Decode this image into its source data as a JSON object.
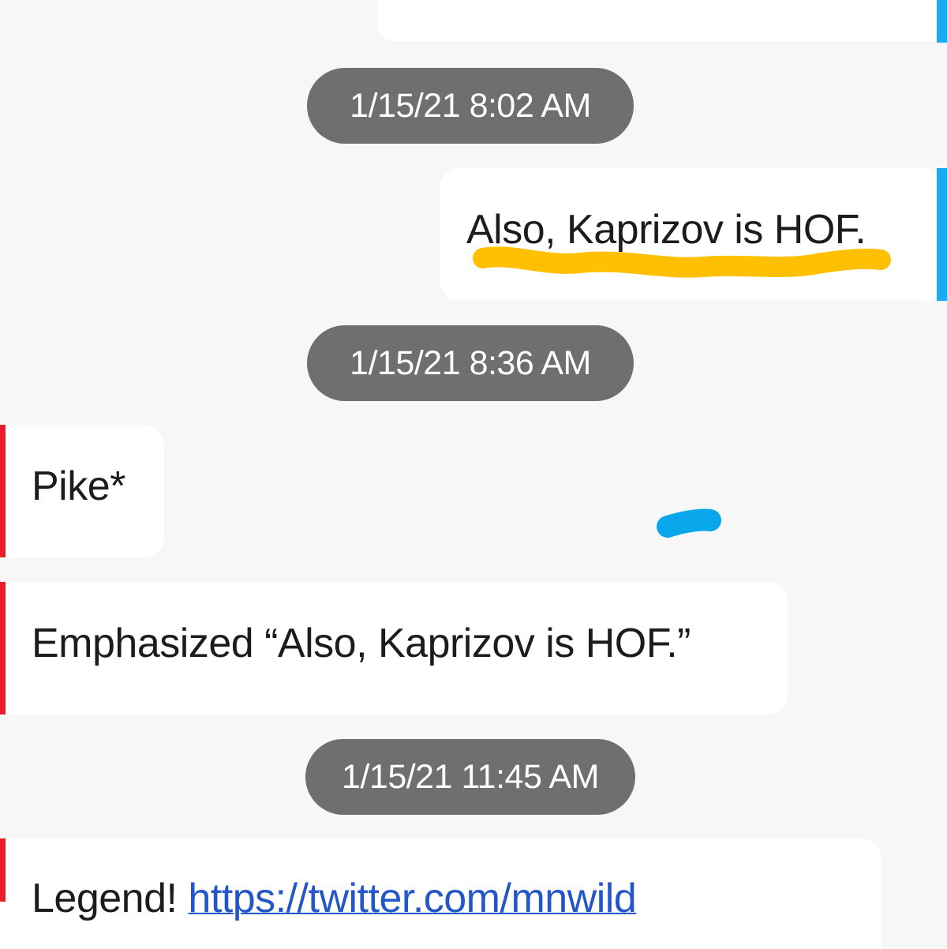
{
  "thread": {
    "timestamps": [
      "1/15/21 8:02 AM",
      "1/15/21 8:36 AM",
      "1/15/21 11:45 AM"
    ],
    "messages": [
      {
        "from": "me",
        "text": "Also, Kaprizov is HOF."
      },
      {
        "from": "them",
        "text": "Pike*"
      },
      {
        "from": "them",
        "text": "Emphasized “Also, Kaprizov is HOF.”"
      },
      {
        "from": "them",
        "text": "Legend! ",
        "link": "https://twitter.com/mnwild"
      }
    ]
  },
  "colors": {
    "background": "#f7f7f7",
    "bubble": "#ffffff",
    "sent_accent": "#1aacf2",
    "received_accent": "#ea1e2a",
    "timestamp_pill": "#6f6f6f",
    "link": "#2256c9",
    "highlight_marker": "#fec000",
    "blue_marker": "#0aa6ec"
  }
}
